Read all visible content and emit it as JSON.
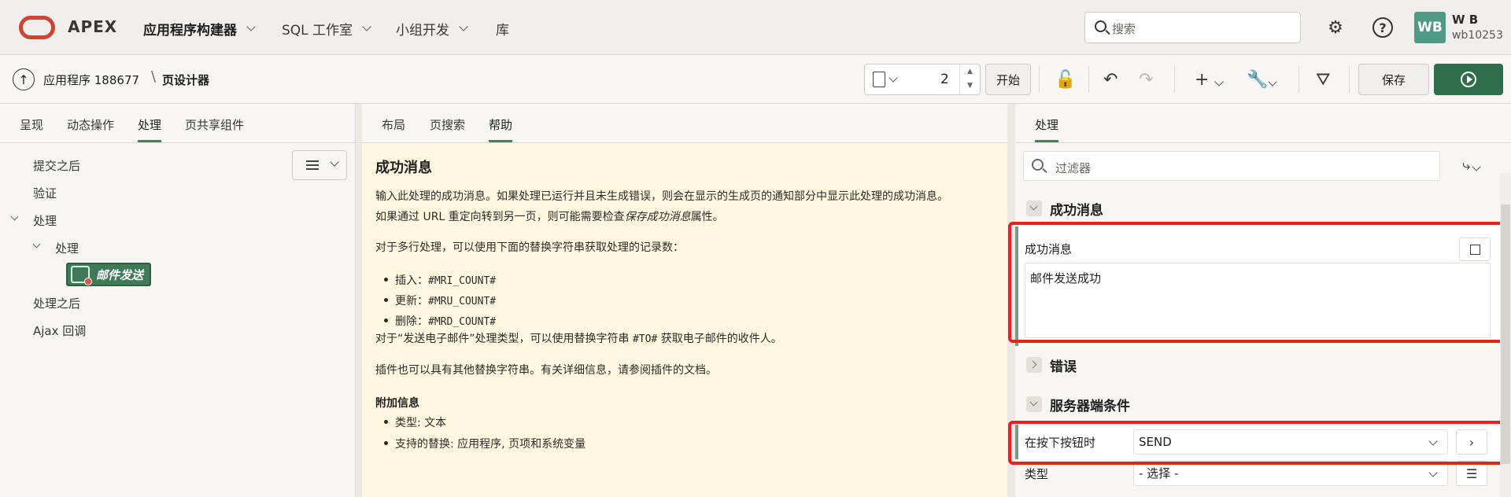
{
  "topbar": {
    "brand": "APEX",
    "nav": [
      {
        "label": "应用程序构建器",
        "has_menu": true,
        "active": true
      },
      {
        "label": "SQL 工作室",
        "has_menu": true,
        "active": false
      },
      {
        "label": "小组开发",
        "has_menu": true,
        "active": false
      },
      {
        "label": "库",
        "has_menu": false,
        "active": false
      }
    ],
    "search_placeholder": "搜索",
    "user": {
      "initials": "WB",
      "name": "W B",
      "id": "wb10253"
    }
  },
  "subbar": {
    "app_crumb": "应用程序 188677",
    "page_crumb": "页设计器",
    "page_number": "2",
    "start_label": "开始",
    "save_label": "保存"
  },
  "left": {
    "tabs": [
      "呈现",
      "动态操作",
      "处理",
      "页共享组件"
    ],
    "active_tab": 2,
    "tree": {
      "after_submit": "提交之后",
      "validation": "验证",
      "processing": "处理",
      "processing_child": "处理",
      "process_node": "邮件发送",
      "after_processing": "处理之后",
      "ajax_callback": "Ajax 回调"
    }
  },
  "middle": {
    "tabs": [
      "布局",
      "页搜索",
      "帮助"
    ],
    "active_tab": 2,
    "help": {
      "title": "成功消息",
      "p1_line1": "输入此处理的成功消息。如果处理已运行并且未生成错误，则会在显示的生成页的通知部分中显示此处理的成功消息。",
      "p1_line2_a": "如果通过 URL 重定向转到另一页，则可能需要检查",
      "p1_line2_em": "保存成功消息",
      "p1_line2_b": "属性。",
      "p2": "对于多行处理，可以使用下面的替换字符串获取处理的记录数：",
      "bullets": [
        {
          "label": "插入：",
          "code": "#MRI_COUNT#"
        },
        {
          "label": "更新：",
          "code": "#MRU_COUNT#"
        },
        {
          "label": "删除：",
          "code": "#MRD_COUNT#"
        }
      ],
      "p3_a": "对于“发送电子邮件”处理类型，可以使用替换字符串 ",
      "p3_code": "#TO#",
      "p3_b": " 获取电子邮件的收件人。",
      "p4": "插件也可以具有其他替换字符串。有关详细信息，请参阅插件的文档。",
      "extra_title": "附加信息",
      "extra": [
        "类型: 文本",
        "支持的替换: 应用程序, 页项和系统变量"
      ]
    }
  },
  "right": {
    "tab": "处理",
    "filter_placeholder": "过滤器",
    "sections": {
      "success": "成功消息",
      "error": "错误",
      "server": "服务器端条件"
    },
    "success_field_label": "成功消息",
    "success_field_value": "邮件发送成功",
    "when_button_label": "在按下按钮时",
    "when_button_value": "SEND",
    "type_label": "类型",
    "type_value": "- 选择 -"
  },
  "colors": {
    "accent_red": "#c74634",
    "run_green": "#2f6e4b",
    "highlight_red": "#e8221b",
    "help_bg": "#fff8e0"
  }
}
